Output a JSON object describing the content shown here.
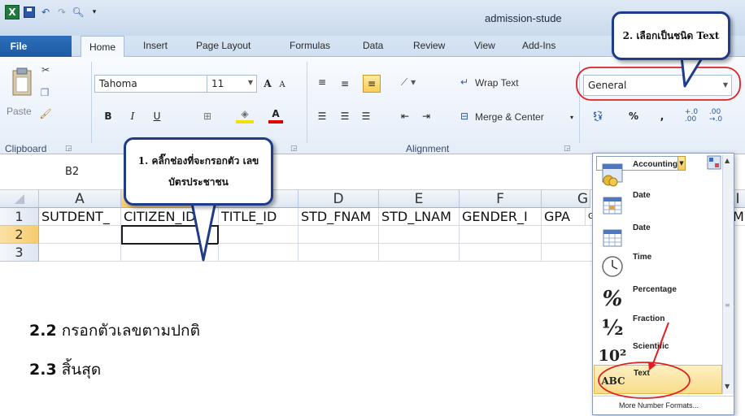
{
  "window": {
    "title": "admission-stude"
  },
  "tabs": [
    "File",
    "Home",
    "Insert",
    "Page Layout",
    "Formulas",
    "Data",
    "Review",
    "View",
    "Add-Ins"
  ],
  "ribbon": {
    "clipboard": {
      "paste_label": "Paste",
      "group_label": "Clipboard"
    },
    "font": {
      "name": "Tahoma",
      "size": "11",
      "bold": "B",
      "italic": "I",
      "underline": "U",
      "grow": "A",
      "shrink": "A",
      "color": "A"
    },
    "alignment": {
      "wrap_text": "Wrap Text",
      "merge_center": "Merge & Center",
      "group_label": "Alignment"
    },
    "number": {
      "format": "General",
      "percent": "%",
      "comma": ",",
      "inc_decimal": "←.0\n.00",
      "dec_decimal": ".00\n→.0"
    }
  },
  "namebox": {
    "value": "B2"
  },
  "grid": {
    "columns": [
      "A",
      "B",
      "C",
      "D",
      "E",
      "F",
      "G",
      "I"
    ],
    "rows": [
      "1",
      "2",
      "3"
    ],
    "row1": [
      "SUTDENT_",
      "CITIZEN_ID",
      "TITLE_ID",
      "STD_FNAM",
      "STD_LNAM",
      "GENDER_I",
      "GPA",
      "G",
      "MI"
    ]
  },
  "instructions": [
    {
      "num": "2.2",
      "text": " กรอกตัวเลขตามปกติ"
    },
    {
      "num": "2.3",
      "text": " สิ้นสุด"
    }
  ],
  "callouts": {
    "step1": "1. คลิ๊กช่องที่จะกรอกตัว เลขบัตรประชาชน",
    "step2": "2. เลือกเป็นชนิด Text"
  },
  "number_formats": [
    {
      "label": "Accounting",
      "icon": "accounting-icon"
    },
    {
      "label": "Date",
      "icon": "calendar-icon"
    },
    {
      "label": "Date",
      "icon": "calendar-icon"
    },
    {
      "label": "Time",
      "icon": "clock-icon"
    },
    {
      "label": "Percentage",
      "icon": "percent-icon",
      "glyph": "%"
    },
    {
      "label": "Fraction",
      "icon": "fraction-icon",
      "glyph": "½"
    },
    {
      "label": "Scientific",
      "icon": "scientific-icon",
      "glyph": "10²"
    },
    {
      "label": "Text",
      "icon": "text-abc-icon",
      "glyph": "ABC"
    }
  ],
  "more_formats": "More Number Formats...",
  "colors": {
    "callout_border": "#1f3c8a",
    "highlight_red": "#e02020",
    "file_tab": "#1d5aa3"
  }
}
